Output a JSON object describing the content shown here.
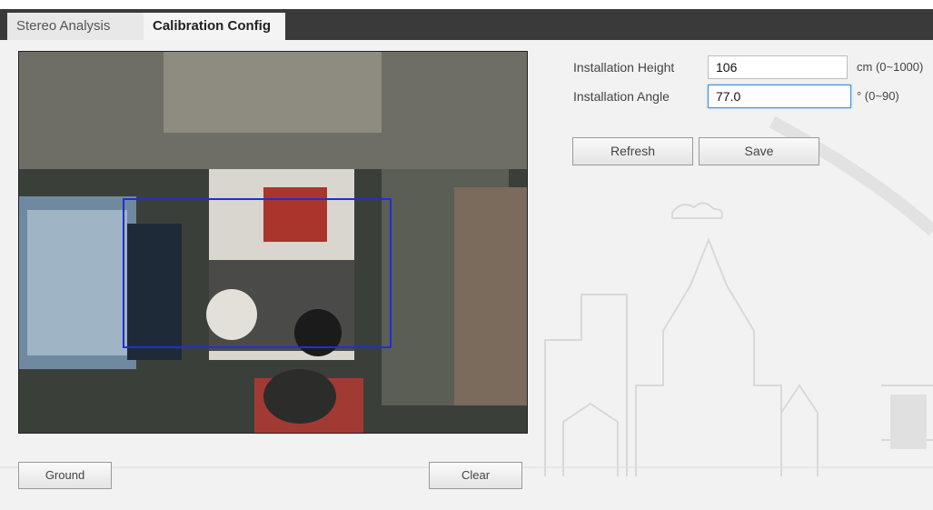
{
  "tabs": [
    {
      "label": "Stereo Analysis"
    },
    {
      "label": "Calibration Config"
    }
  ],
  "settings": {
    "height_label": "Installation Height",
    "height_value": "106",
    "height_unit": "cm (0~1000)",
    "angle_label": "Installation Angle",
    "angle_value": "77.0",
    "angle_unit": "° (0~90)"
  },
  "actions": {
    "refresh_label": "Refresh",
    "save_label": "Save",
    "ground_label": "Ground",
    "clear_label": "Clear"
  },
  "colors": {
    "calibration_box": "#1f2fd6",
    "tab_bar": "#3a3a3a",
    "focus_border": "#3c8fe0"
  }
}
